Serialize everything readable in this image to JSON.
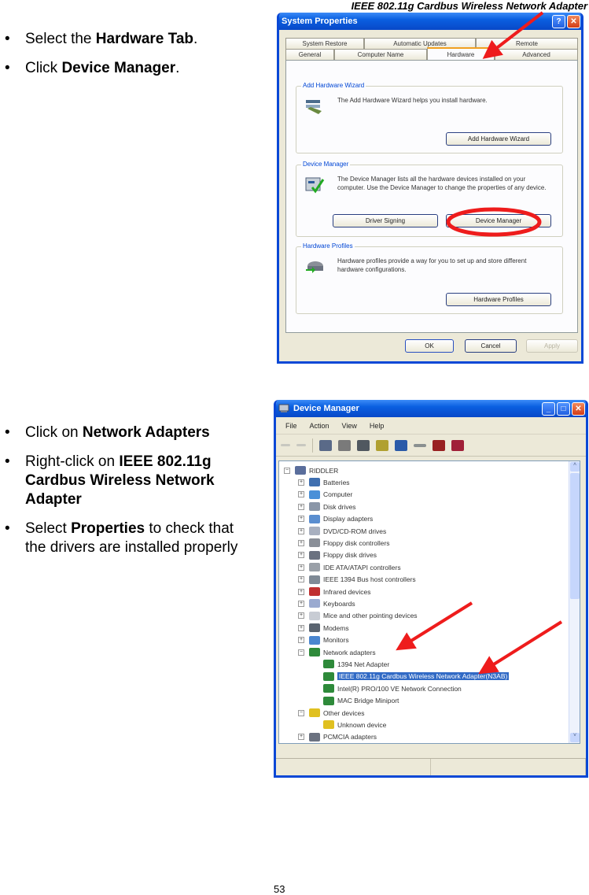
{
  "header": {
    "title": "IEEE 802.11g Cardbus Wireless Network Adapter"
  },
  "instructions_1": [
    {
      "parts": [
        {
          "text": "Select the ",
          "bold": false
        },
        {
          "text": "Hardware Tab",
          "bold": true
        },
        {
          "text": ".",
          "bold": false
        }
      ]
    },
    {
      "parts": [
        {
          "text": "Click ",
          "bold": false
        },
        {
          "text": "Device Manager",
          "bold": true
        },
        {
          "text": ".",
          "bold": false
        }
      ]
    }
  ],
  "instructions_2": [
    {
      "parts": [
        {
          "text": "Click on ",
          "bold": false
        },
        {
          "text": "Network Adapters",
          "bold": true
        }
      ]
    },
    {
      "parts": [
        {
          "text": "Right-click on ",
          "bold": false
        },
        {
          "text": "IEEE 802.11g Cardbus Wireless Network Adapter",
          "bold": true
        }
      ]
    },
    {
      "parts": [
        {
          "text": "Select ",
          "bold": false
        },
        {
          "text": "Properties",
          "bold": true
        },
        {
          "text": " to check that the drivers are installed properly",
          "bold": false
        }
      ]
    }
  ],
  "system_properties": {
    "title": "System Properties",
    "help_glyph": "?",
    "close_glyph": "✕",
    "tabs_back": [
      "System Restore",
      "Automatic Updates",
      "Remote"
    ],
    "tabs_front": [
      "General",
      "Computer Name",
      "Hardware",
      "Advanced"
    ],
    "active_tab": "Hardware",
    "groups": {
      "add_hardware": {
        "title": "Add Hardware Wizard",
        "text": "The Add Hardware Wizard helps you install hardware.",
        "button": "Add Hardware Wizard"
      },
      "device_manager": {
        "title": "Device Manager",
        "text": "The Device Manager lists all the hardware devices installed on your computer. Use the Device Manager to change the properties of any device.",
        "button_left": "Driver Signing",
        "button_right": "Device Manager"
      },
      "hardware_profiles": {
        "title": "Hardware Profiles",
        "text": "Hardware profiles provide a way for you to set up and store different hardware configurations.",
        "button": "Hardware Profiles"
      }
    },
    "buttons": {
      "ok": "OK",
      "cancel": "Cancel",
      "apply": "Apply"
    }
  },
  "device_manager": {
    "title": "Device Manager",
    "window_glyphs": {
      "minimize": "_",
      "maximize": "□",
      "close": "✕"
    },
    "menu": [
      "File",
      "Action",
      "View",
      "Help"
    ],
    "tree": [
      {
        "label": "RIDDLER",
        "level": 0,
        "expander": "−",
        "icon_color": "#5a6e9c"
      },
      {
        "label": "Batteries",
        "level": 1,
        "expander": "+",
        "icon_color": "#3f6fb0"
      },
      {
        "label": "Computer",
        "level": 1,
        "expander": "+",
        "icon_color": "#4a90d8"
      },
      {
        "label": "Disk drives",
        "level": 1,
        "expander": "+",
        "icon_color": "#8a96a8"
      },
      {
        "label": "Display adapters",
        "level": 1,
        "expander": "+",
        "icon_color": "#5a8ed0"
      },
      {
        "label": "DVD/CD-ROM drives",
        "level": 1,
        "expander": "+",
        "icon_color": "#a8b0c0"
      },
      {
        "label": "Floppy disk controllers",
        "level": 1,
        "expander": "+",
        "icon_color": "#8a8f98"
      },
      {
        "label": "Floppy disk drives",
        "level": 1,
        "expander": "+",
        "icon_color": "#6b7280"
      },
      {
        "label": "IDE ATA/ATAPI controllers",
        "level": 1,
        "expander": "+",
        "icon_color": "#9aa0a8"
      },
      {
        "label": "IEEE 1394 Bus host controllers",
        "level": 1,
        "expander": "+",
        "icon_color": "#7f8a96"
      },
      {
        "label": "Infrared devices",
        "level": 1,
        "expander": "+",
        "icon_color": "#c03030"
      },
      {
        "label": "Keyboards",
        "level": 1,
        "expander": "+",
        "icon_color": "#9aaad0"
      },
      {
        "label": "Mice and other pointing devices",
        "level": 1,
        "expander": "+",
        "icon_color": "#c8ccd4"
      },
      {
        "label": "Modems",
        "level": 1,
        "expander": "+",
        "icon_color": "#5a6470"
      },
      {
        "label": "Monitors",
        "level": 1,
        "expander": "+",
        "icon_color": "#4a86d0"
      },
      {
        "label": "Network adapters",
        "level": 1,
        "expander": "−",
        "icon_color": "#2e8a3a"
      },
      {
        "label": "1394 Net Adapter",
        "level": 2,
        "expander": "",
        "icon_color": "#2e8a3a"
      },
      {
        "label": "IEEE 802.11g Cardbus Wireless Network Adapter(N3AB)",
        "level": 2,
        "expander": "",
        "icon_color": "#2e8a3a",
        "selected": true
      },
      {
        "label": "Intel(R) PRO/100 VE Network Connection",
        "level": 2,
        "expander": "",
        "icon_color": "#2e8a3a"
      },
      {
        "label": "MAC Bridge Miniport",
        "level": 2,
        "expander": "",
        "icon_color": "#2e8a3a"
      },
      {
        "label": "Other devices",
        "level": 1,
        "expander": "−",
        "icon_color": "#e0c020"
      },
      {
        "label": "Unknown device",
        "level": 2,
        "expander": "",
        "icon_color": "#e0c020"
      },
      {
        "label": "PCMCIA adapters",
        "level": 1,
        "expander": "+",
        "icon_color": "#6b7280"
      }
    ],
    "scroll_glyphs": {
      "up": "˄",
      "down": "˅"
    }
  },
  "annotation_color": "#ee1c1c",
  "page_number": "53"
}
